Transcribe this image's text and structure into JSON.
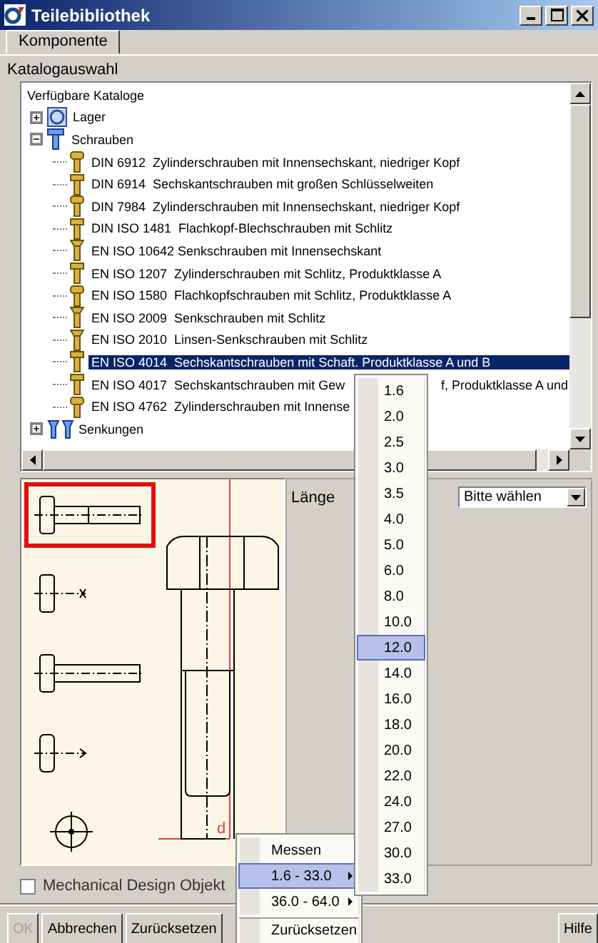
{
  "window": {
    "title": "Teilebibliothek"
  },
  "tabs": [
    {
      "label": "Komponente",
      "selected": true
    }
  ],
  "catalog_section": {
    "label": "Katalogauswahl"
  },
  "tree": {
    "root": {
      "label": "Verfügbare Kataloge",
      "children": [
        {
          "label": "Lager",
          "kind": "bearing",
          "expanded": false,
          "selected": false
        },
        {
          "label": "Schrauben",
          "kind": "screw-group",
          "expanded": true,
          "selected": false,
          "children": [
            {
              "label": "DIN 6912  Zylinderschrauben mit Innensechskant, niedriger Kopf",
              "kind": "socket-screw",
              "selected": false
            },
            {
              "label": "DIN 6914  Sechskantschrauben mit großen Schlüsselweiten",
              "kind": "hex-screw",
              "selected": false
            },
            {
              "label": "DIN 7984  Zylinderschrauben mit Innensechskant, niedriger Kopf",
              "kind": "socket-screw",
              "selected": false
            },
            {
              "label": "DIN ISO 1481  Flachkopf-Blechschrauben mit Schlitz",
              "kind": "hex-screw",
              "selected": false
            },
            {
              "label": "EN ISO 10642 Senkschrauben mit Innensechskant",
              "kind": "countersunk-screw",
              "selected": false
            },
            {
              "label": "EN ISO 1207  Zylinderschrauben mit Schlitz, Produktklasse A",
              "kind": "hex-screw",
              "selected": false
            },
            {
              "label": "EN ISO 1580  Flachkopfschrauben mit Schlitz, Produktklasse A",
              "kind": "socket-screw",
              "selected": false
            },
            {
              "label": "EN ISO 2009  Senkschrauben mit Schlitz",
              "kind": "countersunk-screw",
              "selected": false
            },
            {
              "label": "EN ISO 2010  Linsen-Senkschrauben mit Schlitz",
              "kind": "countersunk-screw",
              "selected": false
            },
            {
              "label": "EN ISO 4014  Sechskantschrauben mit Schaft. Produktklasse A und B",
              "kind": "hex-screw",
              "selected": true
            },
            {
              "label": "EN ISO 4017  Sechskantschrauben mit Gew",
              "label_tail": "f, Produktklasse A und",
              "kind": "hex-screw",
              "selected": false
            },
            {
              "label": "EN ISO 4762  Zylinderschrauben mit Innense",
              "kind": "socket-screw",
              "selected": false
            }
          ]
        },
        {
          "label": "Senkungen",
          "kind": "countersink",
          "expanded": false,
          "selected": false
        }
      ]
    }
  },
  "views": [
    {
      "kind": "side",
      "selected": true
    },
    {
      "kind": "head",
      "selected": false
    },
    {
      "kind": "side-thread",
      "selected": false
    },
    {
      "kind": "head-short",
      "selected": false
    },
    {
      "kind": "top",
      "selected": false
    }
  ],
  "drawing": {
    "dimension_label": "d"
  },
  "parameters": [
    {
      "label": "Länge",
      "value": "Bitte wählen"
    }
  ],
  "mechanical_design_object": {
    "label": "Mechanical Design Objekt",
    "checked": false
  },
  "buttons": [
    {
      "label": "OK",
      "disabled": true
    },
    {
      "label": "Abbrechen",
      "disabled": false
    },
    {
      "label": "Zurücksetzen",
      "disabled": false
    }
  ],
  "help_button": {
    "label": "Hilfe"
  },
  "context_menu": {
    "items": [
      {
        "label": "Messen",
        "selected": false,
        "has_submenu": false,
        "separator_before": false
      },
      {
        "label": "1.6 - 33.0",
        "selected": true,
        "has_submenu": true,
        "separator_before": false
      },
      {
        "label": "36.0 - 64.0",
        "selected": false,
        "has_submenu": true,
        "separator_before": false
      },
      {
        "label": "Zurücksetzen",
        "selected": false,
        "has_submenu": false,
        "separator_before": true
      }
    ]
  },
  "submenu": {
    "items": [
      {
        "label": "1.6",
        "selected": false
      },
      {
        "label": "2.0",
        "selected": false
      },
      {
        "label": "2.5",
        "selected": false
      },
      {
        "label": "3.0",
        "selected": false
      },
      {
        "label": "3.5",
        "selected": false
      },
      {
        "label": "4.0",
        "selected": false
      },
      {
        "label": "5.0",
        "selected": false
      },
      {
        "label": "6.0",
        "selected": false
      },
      {
        "label": "8.0",
        "selected": false
      },
      {
        "label": "10.0",
        "selected": false
      },
      {
        "label": "12.0",
        "selected": true
      },
      {
        "label": "14.0",
        "selected": false
      },
      {
        "label": "16.0",
        "selected": false
      },
      {
        "label": "18.0",
        "selected": false
      },
      {
        "label": "20.0",
        "selected": false
      },
      {
        "label": "22.0",
        "selected": false
      },
      {
        "label": "24.0",
        "selected": false
      },
      {
        "label": "27.0",
        "selected": false
      },
      {
        "label": "30.0",
        "selected": false
      },
      {
        "label": "33.0",
        "selected": false
      }
    ]
  }
}
